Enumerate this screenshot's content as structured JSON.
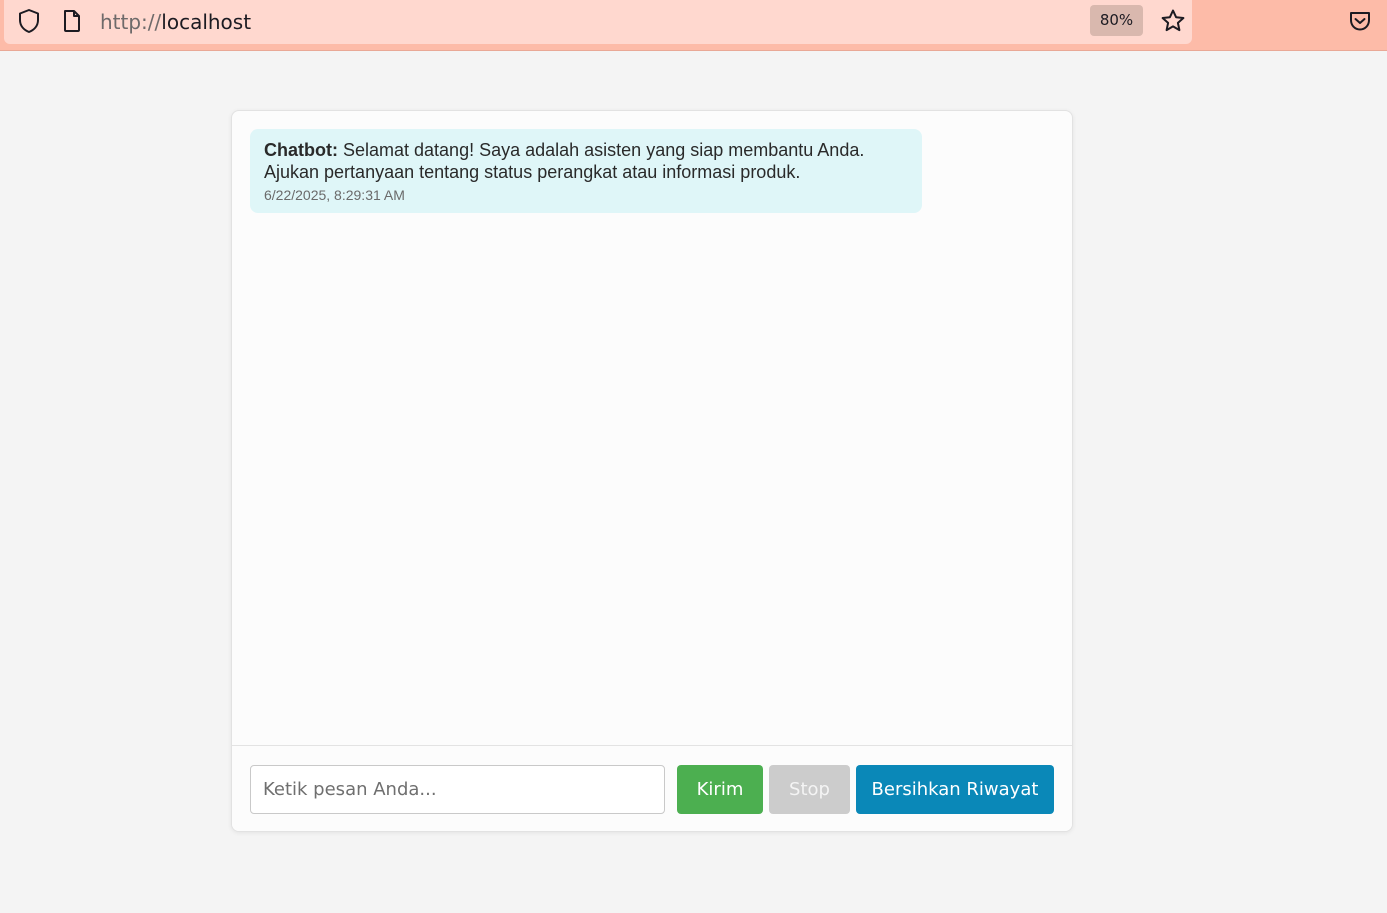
{
  "browser": {
    "url_scheme": "http://",
    "url_host": "localhost",
    "zoom": "80%",
    "icons": {
      "security": "shield-icon",
      "page": "page-icon",
      "bookmark": "star-icon",
      "pocket": "pocket-icon"
    },
    "colors": {
      "toolbar": "#fdbba8",
      "url_field": "#ffd8cf"
    }
  },
  "chat": {
    "messages": [
      {
        "sender": "Chatbot:",
        "text": " Selamat datang! Saya adalah asisten yang siap membantu Anda. Ajukan pertanyaan tentang status perangkat atau informasi produk.",
        "timestamp": "6/22/2025, 8:29:31 AM",
        "bubble_color": "#dff6f8"
      }
    ],
    "input": {
      "placeholder": "Ketik pesan Anda...",
      "value": ""
    },
    "buttons": {
      "send_label": "Kirim",
      "stop_label": "Stop",
      "clear_label": "Bersihkan Riwayat"
    },
    "colors": {
      "send": "#4caf50",
      "stop": "#cccccc",
      "clear": "#0a88b8"
    }
  }
}
